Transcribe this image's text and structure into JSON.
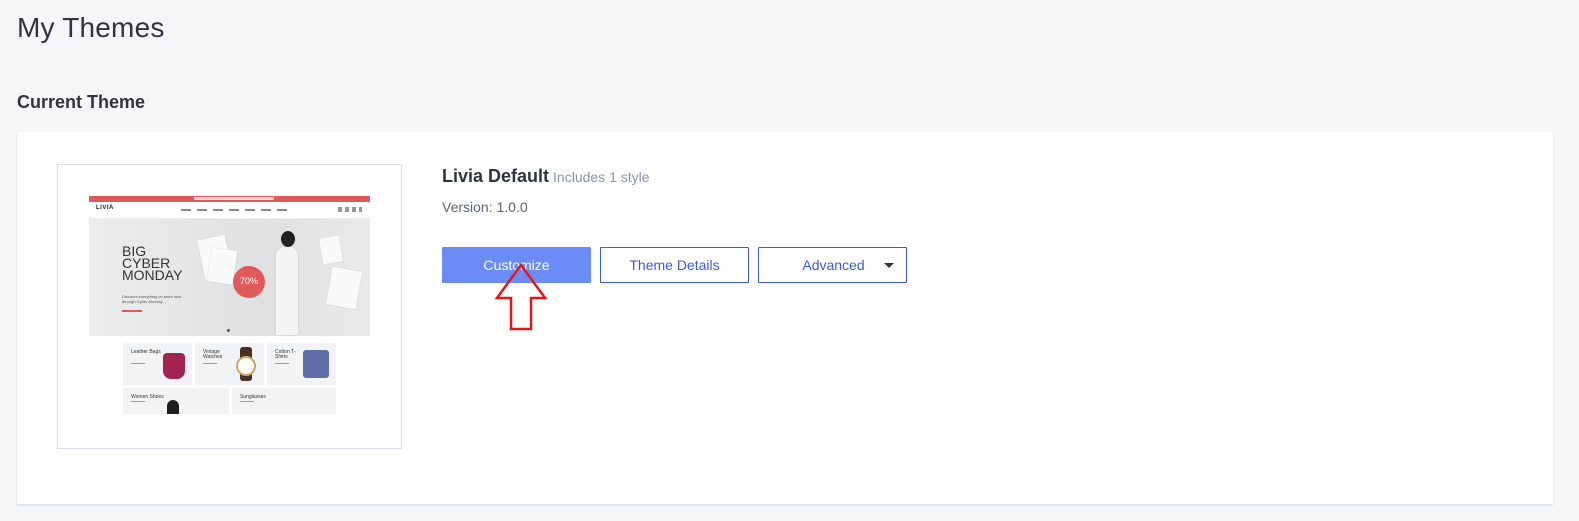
{
  "page": {
    "title": "My Themes"
  },
  "current_theme": {
    "section_title": "Current Theme",
    "name": "Livia Default",
    "styles_note": "Includes 1 style",
    "version_text": "Version: 1.0.0",
    "thumbnail": {
      "logo": "LIVIA",
      "hero_title_lines": [
        "BIG",
        "CYBER",
        "MONDAY"
      ],
      "hero_subtitle": "Discount everything on store now through Cyber Monday",
      "badge": "70%",
      "tiles": [
        "Leather Bags",
        "Vintage Watches",
        "Cotton T-Shirts",
        "Women Shoes",
        "Sunglasses"
      ]
    }
  },
  "actions": {
    "customize_label": "Customize",
    "details_label": "Theme Details",
    "advanced_label": "Advanced"
  },
  "colors": {
    "primary": "#6b8cf5",
    "link": "#3d5bd6",
    "annotation": "#e3161b",
    "accent": "#e05a5a"
  }
}
